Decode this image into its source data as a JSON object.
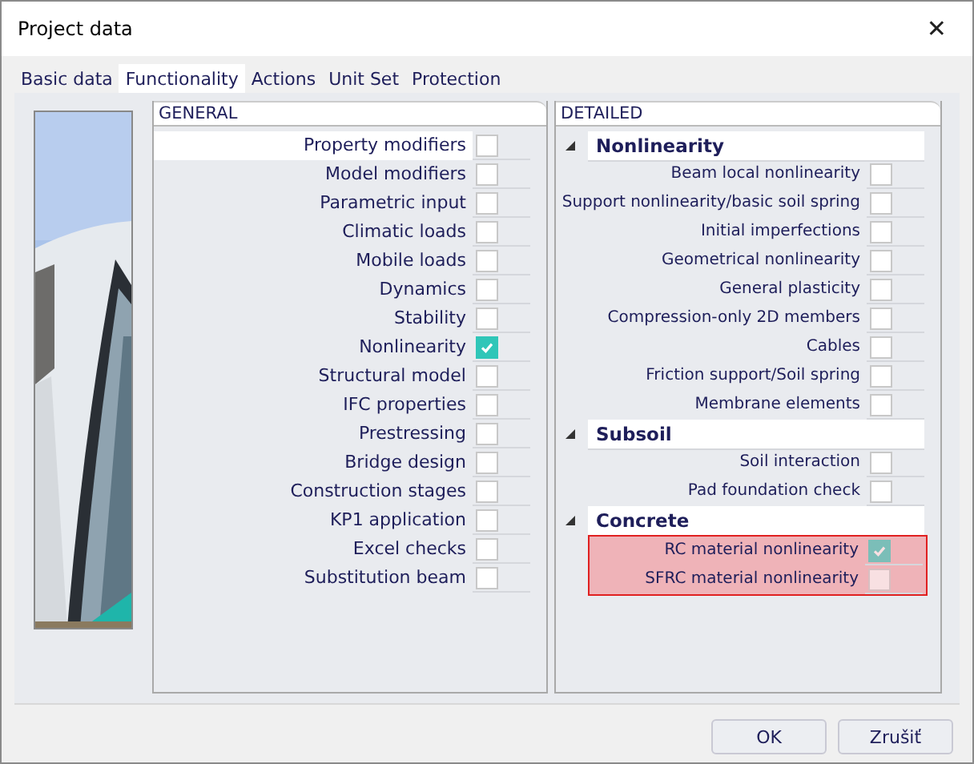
{
  "window": {
    "title": "Project data",
    "close": "✕"
  },
  "tabs": [
    {
      "label": "Basic data",
      "selected": false
    },
    {
      "label": "Functionality",
      "selected": true
    },
    {
      "label": "Actions",
      "selected": false
    },
    {
      "label": "Unit Set",
      "selected": false
    },
    {
      "label": "Protection",
      "selected": false
    }
  ],
  "general": {
    "header": "GENERAL",
    "items": [
      {
        "label": "Property modifiers",
        "checked": false,
        "selected": true
      },
      {
        "label": "Model modifiers",
        "checked": false,
        "selected": false
      },
      {
        "label": "Parametric input",
        "checked": false,
        "selected": false
      },
      {
        "label": "Climatic loads",
        "checked": false,
        "selected": false
      },
      {
        "label": "Mobile loads",
        "checked": false,
        "selected": false
      },
      {
        "label": "Dynamics",
        "checked": false,
        "selected": false
      },
      {
        "label": "Stability",
        "checked": false,
        "selected": false
      },
      {
        "label": "Nonlinearity",
        "checked": true,
        "selected": false
      },
      {
        "label": "Structural model",
        "checked": false,
        "selected": false
      },
      {
        "label": "IFC properties",
        "checked": false,
        "selected": false
      },
      {
        "label": "Prestressing",
        "checked": false,
        "selected": false
      },
      {
        "label": "Bridge design",
        "checked": false,
        "selected": false
      },
      {
        "label": "Construction stages",
        "checked": false,
        "selected": false
      },
      {
        "label": "KP1 application",
        "checked": false,
        "selected": false
      },
      {
        "label": "Excel checks",
        "checked": false,
        "selected": false
      },
      {
        "label": "Substitution beam",
        "checked": false,
        "selected": false
      }
    ]
  },
  "detailed": {
    "header": "DETAILED",
    "groups": [
      {
        "title": "Nonlinearity",
        "expanded": true,
        "items": [
          {
            "label": "Beam local nonlinearity",
            "checked": false,
            "highlighted": false
          },
          {
            "label": "Support nonlinearity/basic soil spring",
            "checked": false,
            "highlighted": false
          },
          {
            "label": "Initial imperfections",
            "checked": false,
            "highlighted": false
          },
          {
            "label": "Geometrical nonlinearity",
            "checked": false,
            "highlighted": false
          },
          {
            "label": "General plasticity",
            "checked": false,
            "highlighted": false
          },
          {
            "label": "Compression-only 2D members",
            "checked": false,
            "highlighted": false
          },
          {
            "label": "Cables",
            "checked": false,
            "highlighted": false
          },
          {
            "label": "Friction support/Soil spring",
            "checked": false,
            "highlighted": false
          },
          {
            "label": "Membrane elements",
            "checked": false,
            "highlighted": false
          }
        ]
      },
      {
        "title": "Subsoil",
        "expanded": true,
        "items": [
          {
            "label": "Soil interaction",
            "checked": false,
            "highlighted": false
          },
          {
            "label": "Pad foundation check",
            "checked": false,
            "highlighted": false
          }
        ]
      },
      {
        "title": "Concrete",
        "expanded": true,
        "items": [
          {
            "label": "RC material nonlinearity",
            "checked": true,
            "highlighted": true
          },
          {
            "label": "SFRC material nonlinearity",
            "checked": false,
            "highlighted": true
          }
        ]
      }
    ]
  },
  "buttons": [
    "OK",
    "Zrušiť"
  ]
}
